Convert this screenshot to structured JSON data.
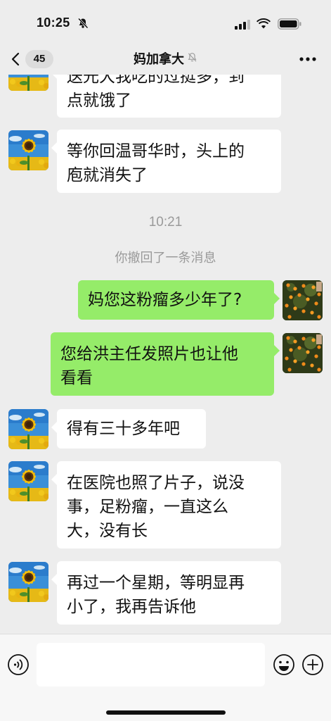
{
  "status_bar": {
    "time": "10:25"
  },
  "nav": {
    "back_count": "45",
    "title": "妈加拿大"
  },
  "messages": {
    "m1_line1": "送光大我吃的过挺多，到",
    "m1_line2": "点就饿了",
    "m2_line1": "等你回温哥华时，头上的",
    "m2_line2": "庖就消失了",
    "time": "10:21",
    "recall": "你撤回了一条消息",
    "m3": "妈您这粉瘤多少年了?",
    "m4_line1": "您给洪主任发照片也让他",
    "m4_line2": "看看",
    "m5": "得有三十多年吧",
    "m6_line1": "在医院也照了片子，说没",
    "m6_line2": "事，足粉瘤，一直这么",
    "m6_line3": "大，没有长",
    "m7_line1": "再过一个星期，等明显再",
    "m7_line2": "小了，我再告诉他"
  },
  "icons": {
    "mute": "bell-slash-icon",
    "signal": "cellular-signal-icon",
    "wifi": "wifi-icon",
    "battery": "battery-icon",
    "back": "chevron-left-icon",
    "more": "more-dots-icon",
    "voice": "voice-icon",
    "emoji": "emoji-icon",
    "plus": "plus-icon"
  },
  "colors": {
    "background": "#ededed",
    "outgoing_bubble": "#95ec69",
    "incoming_bubble": "#ffffff",
    "meta_text": "#9a9a9a"
  }
}
